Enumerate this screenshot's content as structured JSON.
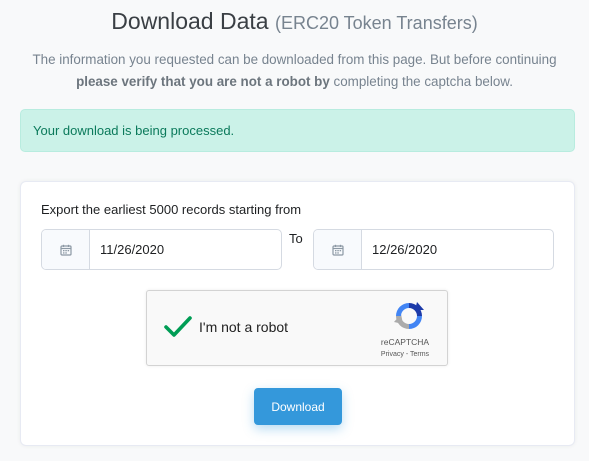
{
  "page": {
    "title": "Download Data",
    "subtitle": "(ERC20 Token Transfers)"
  },
  "intro": {
    "text_before": "The information you requested can be downloaded from this page. But before continuing ",
    "bold": "please verify that you are not a robot by",
    "text_after": " completing the captcha below."
  },
  "alert": {
    "message": "Your download is being processed."
  },
  "export": {
    "label": "Export the earliest 5000 records starting from",
    "from_value": "11/26/2020",
    "to_label": "To",
    "to_value": "12/26/2020"
  },
  "captcha": {
    "label": "I'm not a robot",
    "brand": "reCAPTCHA",
    "privacy": "Privacy",
    "separator": "-",
    "terms": "Terms",
    "checked": true
  },
  "actions": {
    "download_label": "Download"
  },
  "colors": {
    "accent": "#3498db",
    "success_bg": "#cbf2e8",
    "success_text": "#0b7a5b",
    "check": "#009d55"
  },
  "icons": {
    "date_addon": "calendar-icon",
    "captcha_check": "checkmark-icon",
    "captcha_logo": "recaptcha-logo-icon"
  }
}
